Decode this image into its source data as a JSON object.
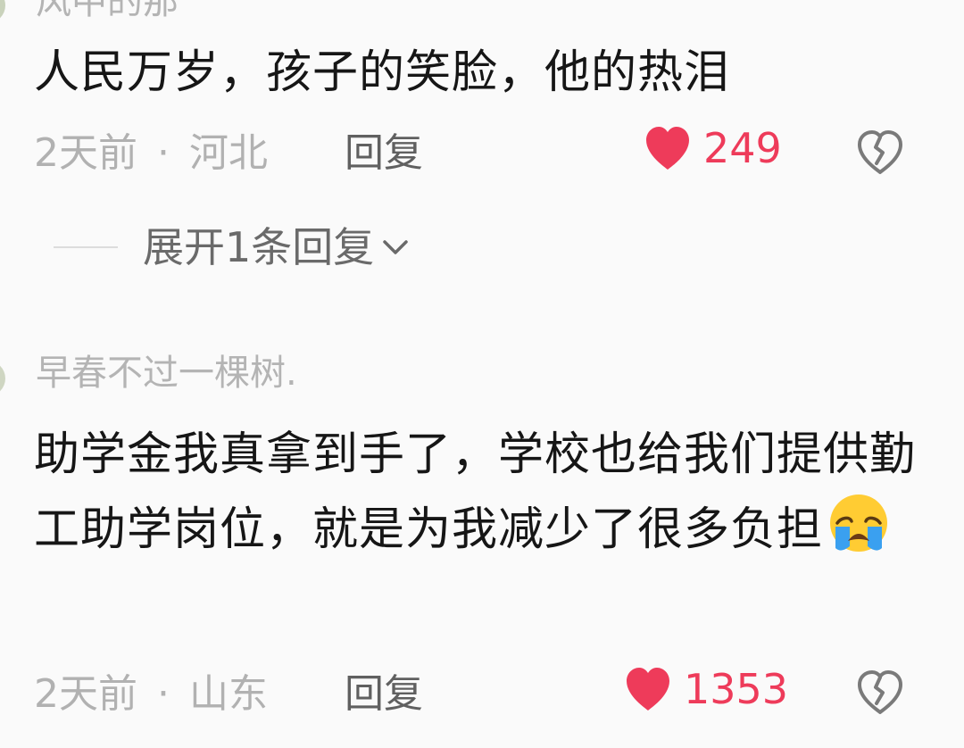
{
  "comments": [
    {
      "username": "风中的那",
      "text": "人民万岁，孩子的笑脸，他的热泪",
      "time": "2天前",
      "separator": "·",
      "location": "河北",
      "reply_label": "回复",
      "likes": "249",
      "expand_label": "展开1条回复"
    },
    {
      "username": "早春不过一棵树.",
      "text": "助学金我真拿到手了，学校也给我们提供勤工助学岗位，就是为我减少了很多负担",
      "emoji": "loudly-crying-face",
      "time": "2天前",
      "separator": "·",
      "location": "山东",
      "reply_label": "回复",
      "likes": "1353"
    }
  ],
  "colors": {
    "background": "#fafafa",
    "like_red": "#ee3b5a",
    "meta_gray": "#b1b1b1",
    "text_black": "#161616"
  },
  "icons": {
    "like": "heart-icon",
    "dislike": "broken-heart-icon",
    "expand": "chevron-down-icon"
  }
}
